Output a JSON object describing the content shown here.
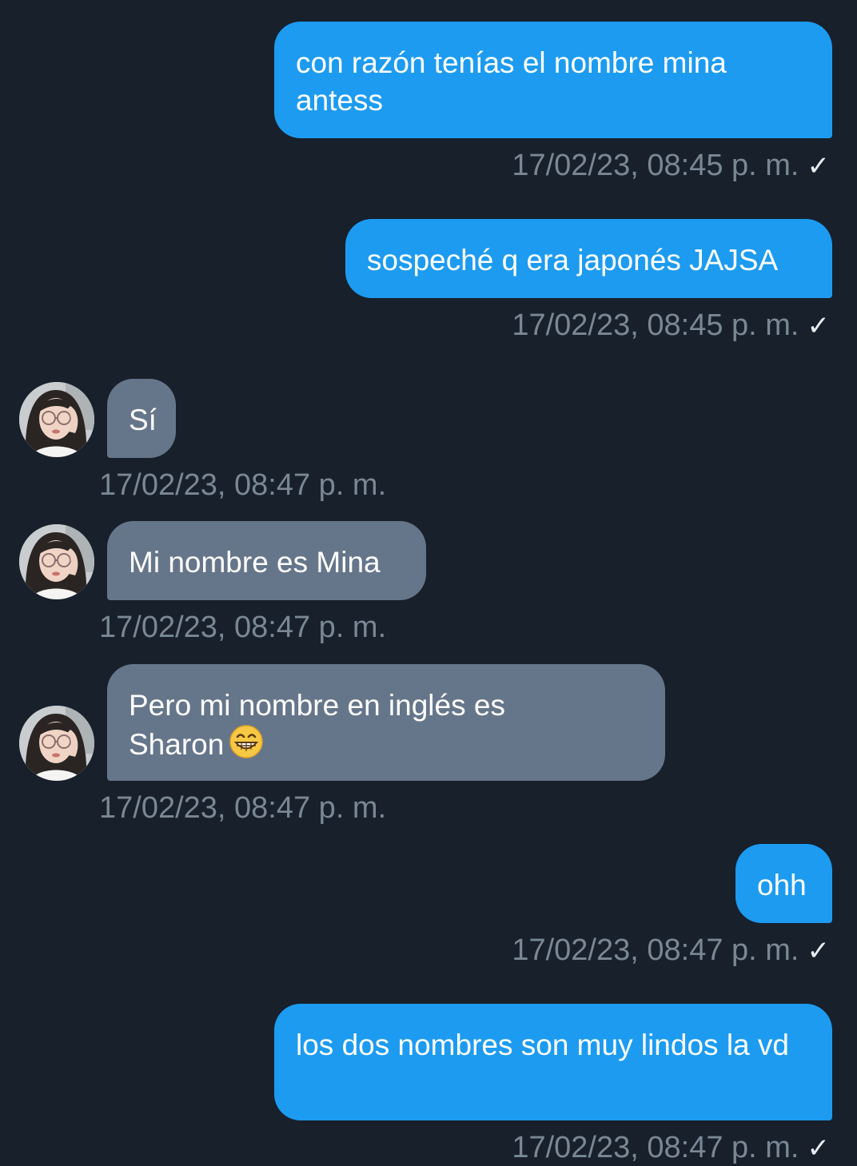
{
  "messages": [
    {
      "direction": "sent",
      "text": "con razón tenías el nombre mina antess",
      "timestamp": "17/02/23, 08:45 p. m.",
      "status_icon": "check-icon"
    },
    {
      "direction": "sent",
      "text": "sospeché q era japonés JAJSA",
      "timestamp": "17/02/23, 08:45 p. m.",
      "status_icon": "check-icon"
    },
    {
      "direction": "received",
      "text": "Sí",
      "timestamp": "17/02/23, 08:47 p. m."
    },
    {
      "direction": "received",
      "text": "Mi nombre es Mina",
      "timestamp": "17/02/23, 08:47 p. m."
    },
    {
      "direction": "received",
      "text_line1": "Pero mi nombre en inglés es",
      "text_line2": "Sharon",
      "emoji": "grinning-face-icon",
      "timestamp": "17/02/23, 08:47 p. m."
    },
    {
      "direction": "sent",
      "text": "ohh",
      "timestamp": "17/02/23, 08:47 p. m.",
      "status_icon": "check-icon"
    },
    {
      "direction": "sent",
      "text": "los dos nombres son muy lindos la vd",
      "timestamp": "17/02/23, 08:47 p. m.",
      "status_icon": "check-icon"
    }
  ],
  "check_glyph": "✓",
  "colors": {
    "background": "#17202b",
    "sent_bubble": "#1d9bf0",
    "received_bubble": "#66768a",
    "timestamp": "#7a8794",
    "text": "#ffffff"
  }
}
